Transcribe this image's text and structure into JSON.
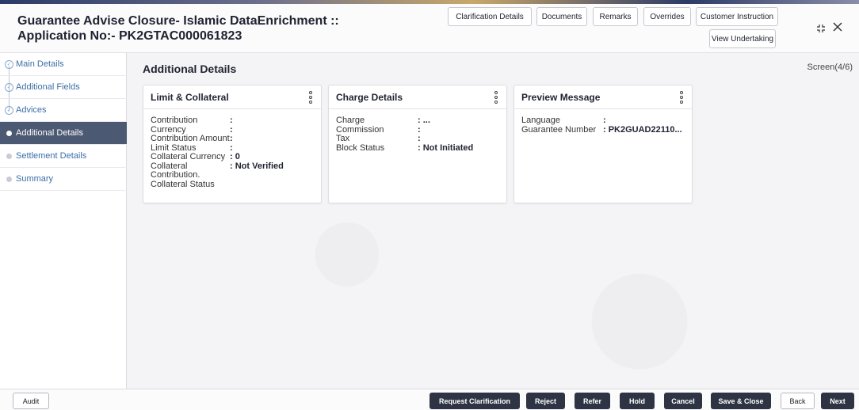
{
  "header": {
    "title_line1": "Guarantee Advise Closure- Islamic DataEnrichment ::",
    "title_line2": "Application No:- PK2GTAC000061823",
    "buttons": {
      "clarification": "Clarification Details",
      "documents": "Documents",
      "remarks": "Remarks",
      "overrides": "Overrides",
      "customer_instruction": "Customer Instruction",
      "view_undertaking": "View Undertaking"
    },
    "icons": {
      "minimize": "collapse-icon",
      "close": "close-icon"
    }
  },
  "sidebar": {
    "items": [
      {
        "label": "Main Details",
        "state": "done"
      },
      {
        "label": "Additional Fields",
        "state": "done"
      },
      {
        "label": "Advices",
        "state": "done"
      },
      {
        "label": "Additional Details",
        "state": "active"
      },
      {
        "label": "Settlement Details",
        "state": "pending"
      },
      {
        "label": "Summary",
        "state": "pending"
      }
    ]
  },
  "main": {
    "section_title": "Additional Details",
    "screen_indicator": "Screen(4/6)",
    "cards": {
      "limit": {
        "title": "Limit & Collateral",
        "rows": [
          {
            "k": "Contribution",
            "v": ":"
          },
          {
            "k": "Currency",
            "v": ":"
          },
          {
            "k": "Contribution Amount",
            "v": ":"
          },
          {
            "k": "Limit Status",
            "v": ":"
          },
          {
            "k": "Collateral Currency",
            "v": ": 0"
          },
          {
            "k": "Collateral",
            "v": ": Not Verified"
          },
          {
            "k": "Contribution.",
            "v": ""
          },
          {
            "k": "Collateral Status",
            "v": ""
          }
        ]
      },
      "charge": {
        "title": "Charge Details",
        "rows": [
          {
            "k": "Charge",
            "v": ": ..."
          },
          {
            "k": "Commission",
            "v": ":"
          },
          {
            "k": "Tax",
            "v": ":"
          },
          {
            "k": "Block Status",
            "v": ": Not Initiated"
          }
        ]
      },
      "preview": {
        "title": "Preview Message",
        "rows": [
          {
            "k": "Language",
            "v": ":"
          },
          {
            "k": "Guarantee Number",
            "v": ": PK2GUAD22110..."
          }
        ]
      }
    }
  },
  "footer": {
    "audit": "Audit",
    "request_clarification": "Request Clarification",
    "reject": "Reject",
    "refer": "Refer",
    "hold": "Hold",
    "cancel": "Cancel",
    "save_close": "Save & Close",
    "back": "Back",
    "next": "Next"
  },
  "colors": {
    "active_nav": "#4c5973",
    "link": "#3c6ea8",
    "dark_button": "#2e3444"
  }
}
